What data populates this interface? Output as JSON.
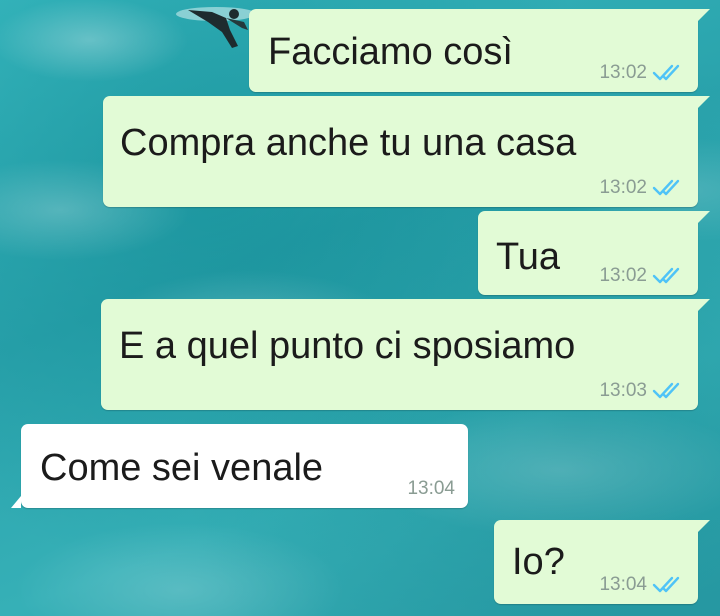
{
  "chat": {
    "background": "surfing-ocean-wallpaper",
    "accent_color": "#4fc3f7",
    "outgoing_bubble_color": "#e2fbd6",
    "incoming_bubble_color": "#ffffff",
    "messages": [
      {
        "direction": "outgoing",
        "text": "Facciamo così",
        "time": "13:02",
        "status_icon": "double-check-icon"
      },
      {
        "direction": "outgoing",
        "text": "Compra anche tu una casa",
        "time": "13:02",
        "status_icon": "double-check-icon"
      },
      {
        "direction": "outgoing",
        "text": "Tua",
        "time": "13:02",
        "status_icon": "double-check-icon"
      },
      {
        "direction": "outgoing",
        "text": "E a quel punto ci sposiamo",
        "time": "13:03",
        "status_icon": "double-check-icon"
      },
      {
        "direction": "incoming",
        "text": "Come sei venale",
        "time": "13:04"
      },
      {
        "direction": "outgoing",
        "text": "Io?",
        "time": "13:04",
        "status_icon": "double-check-icon"
      }
    ]
  }
}
